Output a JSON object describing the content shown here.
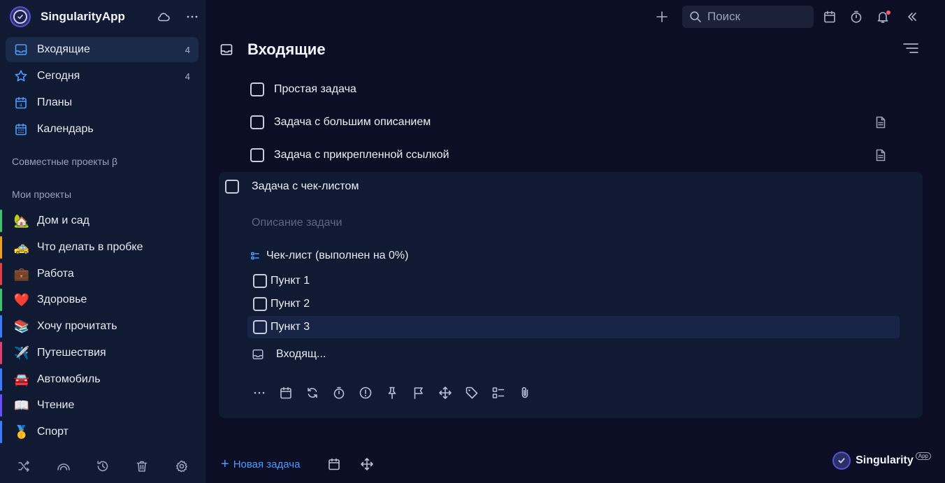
{
  "app": {
    "name": "SingularityApp"
  },
  "sidebar": {
    "nav": [
      {
        "label": "Входящие",
        "count": "4",
        "icon": "inbox-icon"
      },
      {
        "label": "Сегодня",
        "count": "4",
        "icon": "star-icon"
      },
      {
        "label": "Планы",
        "count": "",
        "icon": "calendar-day-icon"
      },
      {
        "label": "Календарь",
        "count": "",
        "icon": "calendar-grid-icon"
      }
    ],
    "shared_projects_title": "Совместные проекты β",
    "my_projects_title": "Мои проекты",
    "projects": [
      {
        "emoji": "🏡",
        "label": "Дом и сад",
        "color": "#3ec46d"
      },
      {
        "emoji": "🚕",
        "label": "Что делать в пробке",
        "color": "#f0a020"
      },
      {
        "emoji": "💼",
        "label": "Работа",
        "color": "#e04040"
      },
      {
        "emoji": "❤️",
        "label": "Здоровье",
        "color": "#3ec46d"
      },
      {
        "emoji": "📚",
        "label": "Хочу прочитать",
        "color": "#3a7bff"
      },
      {
        "emoji": "✈️",
        "label": "Путешествия",
        "color": "#e04070"
      },
      {
        "emoji": "🚘",
        "label": "Автомобиль",
        "color": "#3a7bff"
      },
      {
        "emoji": "📖",
        "label": "Чтение",
        "color": "#6a4bff"
      },
      {
        "emoji": "🥇",
        "label": "Спорт",
        "color": "#3a7bff"
      }
    ]
  },
  "topbar": {
    "search_placeholder": "Поиск"
  },
  "main": {
    "title": "Входящие",
    "tasks": [
      {
        "label": "Простая задача",
        "has_note": false
      },
      {
        "label": "Задача с большим описанием",
        "has_note": true
      },
      {
        "label": "Задача с прикрепленной ссылкой",
        "has_note": true
      }
    ],
    "expanded_task": {
      "label": "Задача с чек-листом",
      "description_placeholder": "Описание задачи",
      "checklist_title": "Чек-лист (выполнен на 0%)",
      "checklist_items": [
        "Пункт 1",
        "Пункт 2",
        "Пункт 3"
      ],
      "project": "Входящ..."
    }
  },
  "bottombar": {
    "new_task_label": "Новая задача"
  },
  "brand": {
    "name": "Singularity",
    "badge": "App"
  },
  "colors": {
    "accent": "#4c9dff",
    "background": "#0b0e24",
    "sidebar": "#111a33",
    "notification": "#ff5a6b"
  }
}
